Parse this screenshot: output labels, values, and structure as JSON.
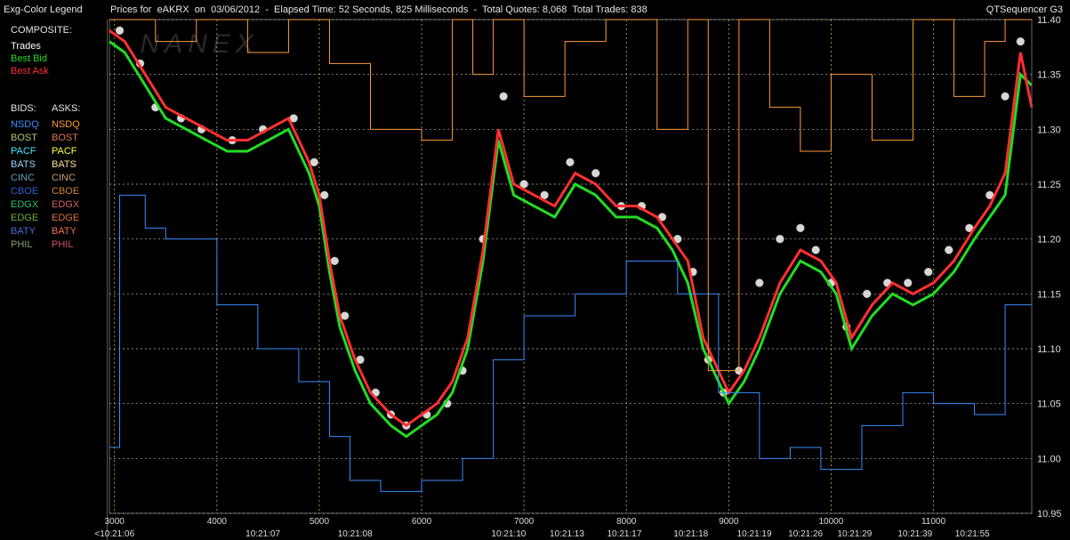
{
  "legend": {
    "title": "Exg-Color Legend",
    "composite_label": "COMPOSITE:",
    "composite": [
      {
        "label": "Trades",
        "color": "#ffffff"
      },
      {
        "label": "Best Bid",
        "color": "#22dd22"
      },
      {
        "label": "Best Ask",
        "color": "#ff3030"
      }
    ],
    "bids_label": "BIDS:",
    "asks_label": "ASKS:",
    "exchanges": [
      {
        "bid": "NSDQ",
        "ask": "NSDQ",
        "bid_color": "#3a8cff",
        "ask_color": "#ff9a3a"
      },
      {
        "bid": "BOST",
        "ask": "BOST",
        "bid_color": "#b0c870",
        "ask_color": "#e0705a"
      },
      {
        "bid": "PACF",
        "ask": "PACF",
        "bid_color": "#40e8ff",
        "ask_color": "#ffff40"
      },
      {
        "bid": "BATS",
        "ask": "BATS",
        "bid_color": "#a0d0ff",
        "ask_color": "#ffe090"
      },
      {
        "bid": "CINC",
        "ask": "CINC",
        "bid_color": "#5aa0c0",
        "ask_color": "#c8a070"
      },
      {
        "bid": "CBOE",
        "ask": "CBOE",
        "bid_color": "#2a60d0",
        "ask_color": "#d08030"
      },
      {
        "bid": "EDGX",
        "ask": "EDGX",
        "bid_color": "#30c070",
        "ask_color": "#d86060"
      },
      {
        "bid": "EDGE",
        "ask": "EDGE",
        "bid_color": "#70b040",
        "ask_color": "#e07040"
      },
      {
        "bid": "BATY",
        "ask": "BATY",
        "bid_color": "#4070e0",
        "ask_color": "#f07050"
      },
      {
        "bid": "PHIL",
        "ask": "PHIL",
        "bid_color": "#80a070",
        "ask_color": "#d05070"
      }
    ]
  },
  "header": {
    "chart_title": "Prices for  eAKRX  on  03/06/2012  -  Elapsed Time: 52 Seconds, 825 Milliseconds  -  Total Quotes: 8,068  Total Trades: 838",
    "app_name": "QTSequencer G3"
  },
  "chart_data": {
    "type": "line",
    "title": "Prices for  eAKRX  on  03/06/2012  -  Elapsed Time: 52 Seconds, 825 Milliseconds  -  Total Quotes: 8,068  Total Trades: 838",
    "xlim": [
      2950,
      11960
    ],
    "ylim": [
      10.95,
      11.4
    ],
    "x_ticks": [
      3000,
      4000,
      5000,
      6000,
      7000,
      8000,
      9000,
      10000,
      11000
    ],
    "x_time_labels": [
      {
        "x": 3000,
        "label": "<10:21:06"
      },
      {
        "x": 4450,
        "label": "10:21:07"
      },
      {
        "x": 5350,
        "label": "10:21:08"
      },
      {
        "x": 6850,
        "label": "10:21:10"
      },
      {
        "x": 7420,
        "label": "10:21:13"
      },
      {
        "x": 7980,
        "label": "10:21:17"
      },
      {
        "x": 8630,
        "label": "10:21:18"
      },
      {
        "x": 9250,
        "label": "10:21:19"
      },
      {
        "x": 9750,
        "label": "10:21:26"
      },
      {
        "x": 10230,
        "label": "10:21:29"
      },
      {
        "x": 10820,
        "label": "10:21:39"
      },
      {
        "x": 11380,
        "label": "10:21:55"
      }
    ],
    "y_ticks": [
      10.95,
      11.0,
      11.05,
      11.1,
      11.15,
      11.2,
      11.25,
      11.3,
      11.35,
      11.4
    ],
    "grid": true,
    "watermark": "NANEX",
    "series": [
      {
        "name": "Trades",
        "style": "marker",
        "color": "#d8d8d8",
        "x": [
          3050,
          3250,
          3400,
          3650,
          3850,
          4150,
          4450,
          4750,
          4950,
          5050,
          5150,
          5250,
          5400,
          5550,
          5700,
          5850,
          6050,
          6250,
          6400,
          6600,
          6800,
          7000,
          7200,
          7450,
          7700,
          7950,
          8150,
          8350,
          8500,
          8650,
          8800,
          8950,
          9100,
          9300,
          9500,
          9700,
          9850,
          10000,
          10150,
          10350,
          10550,
          10750,
          10950,
          11150,
          11350,
          11550,
          11700,
          11850
        ],
        "y": [
          11.39,
          11.36,
          11.32,
          11.31,
          11.3,
          11.29,
          11.3,
          11.31,
          11.27,
          11.24,
          11.18,
          11.13,
          11.09,
          11.06,
          11.04,
          11.03,
          11.04,
          11.05,
          11.08,
          11.2,
          11.33,
          11.25,
          11.24,
          11.27,
          11.26,
          11.23,
          11.23,
          11.22,
          11.2,
          11.17,
          11.09,
          11.06,
          11.08,
          11.16,
          11.2,
          11.21,
          11.19,
          11.16,
          11.12,
          11.15,
          11.16,
          11.16,
          11.17,
          11.19,
          11.21,
          11.24,
          11.33,
          11.38
        ]
      },
      {
        "name": "Best Bid",
        "style": "line",
        "color": "#22dd22",
        "x": [
          2950,
          3100,
          3300,
          3500,
          3700,
          3900,
          4100,
          4300,
          4500,
          4700,
          4900,
          5000,
          5100,
          5200,
          5350,
          5500,
          5700,
          5850,
          6000,
          6150,
          6300,
          6450,
          6600,
          6750,
          6900,
          7100,
          7300,
          7500,
          7700,
          7900,
          8100,
          8300,
          8450,
          8600,
          8750,
          8850,
          9000,
          9150,
          9300,
          9500,
          9700,
          9900,
          10050,
          10200,
          10400,
          10600,
          10800,
          11000,
          11200,
          11400,
          11550,
          11700,
          11850,
          11960
        ],
        "y": [
          11.38,
          11.37,
          11.34,
          11.31,
          11.3,
          11.29,
          11.28,
          11.28,
          11.29,
          11.3,
          11.26,
          11.23,
          11.17,
          11.12,
          11.08,
          11.05,
          11.03,
          11.02,
          11.03,
          11.04,
          11.06,
          11.1,
          11.18,
          11.29,
          11.24,
          11.23,
          11.22,
          11.25,
          11.24,
          11.22,
          11.22,
          11.21,
          11.19,
          11.16,
          11.1,
          11.08,
          11.05,
          11.07,
          11.1,
          11.15,
          11.18,
          11.17,
          11.15,
          11.1,
          11.13,
          11.15,
          11.14,
          11.15,
          11.17,
          11.2,
          11.22,
          11.24,
          11.35,
          11.34
        ]
      },
      {
        "name": "Best Ask",
        "style": "line",
        "color": "#ff3030",
        "x": [
          2950,
          3100,
          3300,
          3500,
          3700,
          3900,
          4100,
          4300,
          4500,
          4700,
          4900,
          5000,
          5100,
          5200,
          5350,
          5500,
          5700,
          5850,
          6000,
          6150,
          6300,
          6450,
          6600,
          6750,
          6900,
          7100,
          7300,
          7500,
          7700,
          7900,
          8100,
          8300,
          8450,
          8600,
          8750,
          8850,
          9000,
          9150,
          9300,
          9500,
          9700,
          9900,
          10050,
          10200,
          10400,
          10600,
          10800,
          11000,
          11200,
          11400,
          11550,
          11700,
          11850,
          11960
        ],
        "y": [
          11.39,
          11.38,
          11.35,
          11.32,
          11.31,
          11.3,
          11.29,
          11.29,
          11.3,
          11.31,
          11.27,
          11.24,
          11.18,
          11.13,
          11.09,
          11.06,
          11.04,
          11.03,
          11.04,
          11.05,
          11.07,
          11.11,
          11.19,
          11.3,
          11.25,
          11.24,
          11.23,
          11.26,
          11.25,
          11.23,
          11.23,
          11.22,
          11.2,
          11.18,
          11.11,
          11.09,
          11.06,
          11.08,
          11.11,
          11.16,
          11.19,
          11.18,
          11.16,
          11.11,
          11.14,
          11.16,
          11.15,
          11.16,
          11.18,
          11.21,
          11.23,
          11.26,
          11.37,
          11.32
        ]
      },
      {
        "name": "NSDQ Bid",
        "style": "step",
        "color": "#3a8cff",
        "x": [
          2950,
          3050,
          3300,
          3500,
          4000,
          4400,
          4800,
          5100,
          5300,
          5600,
          6000,
          6400,
          6700,
          7000,
          7500,
          8000,
          8500,
          8900,
          9300,
          9600,
          9900,
          10300,
          10700,
          11000,
          11400,
          11700,
          11960
        ],
        "y": [
          11.01,
          11.24,
          11.21,
          11.2,
          11.14,
          11.1,
          11.07,
          11.02,
          10.98,
          10.97,
          10.98,
          11.0,
          11.09,
          11.13,
          11.15,
          11.18,
          11.15,
          11.06,
          11.0,
          11.01,
          10.99,
          11.03,
          11.06,
          11.05,
          11.04,
          11.14,
          11.18
        ]
      },
      {
        "name": "NSDQ Ask",
        "style": "step",
        "color": "#ff9a3a",
        "x": [
          2950,
          3400,
          3800,
          4300,
          4700,
          5100,
          5500,
          6000,
          6300,
          6500,
          6700,
          7000,
          7400,
          7800,
          8300,
          8600,
          8800,
          9100,
          9400,
          9700,
          10000,
          10400,
          10800,
          11200,
          11500,
          11700,
          11960
        ],
        "y": [
          11.4,
          11.38,
          11.4,
          11.37,
          11.4,
          11.36,
          11.3,
          11.29,
          11.4,
          11.35,
          11.4,
          11.33,
          11.38,
          11.4,
          11.3,
          11.4,
          11.08,
          11.4,
          11.32,
          11.28,
          11.35,
          11.29,
          11.4,
          11.33,
          11.38,
          11.4,
          11.4
        ]
      }
    ]
  }
}
